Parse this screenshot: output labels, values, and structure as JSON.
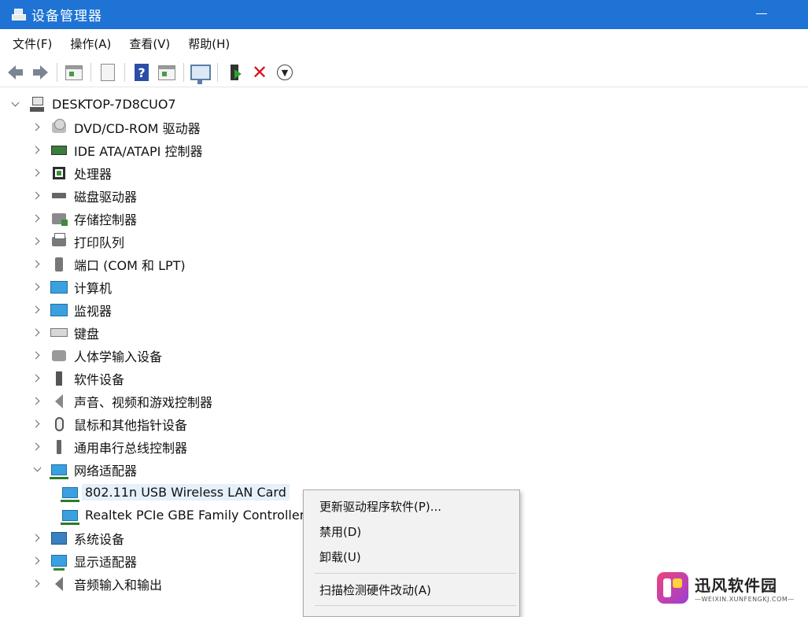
{
  "window": {
    "title": "设备管理器"
  },
  "menu": [
    "文件(F)",
    "操作(A)",
    "查看(V)",
    "帮助(H)"
  ],
  "toolbar_icons": [
    "back-arrow-icon",
    "forward-arrow-icon",
    "show-hide-console-tree-icon",
    "properties-icon",
    "help-icon",
    "action-pane-icon",
    "scan-hardware-icon",
    "update-driver-icon",
    "uninstall-icon",
    "download-icon"
  ],
  "tree": {
    "root": "DESKTOP-7D8CUO7",
    "categories": [
      "DVD/CD-ROM 驱动器",
      "IDE ATA/ATAPI 控制器",
      "处理器",
      "磁盘驱动器",
      "存储控制器",
      "打印队列",
      "端口 (COM 和 LPT)",
      "计算机",
      "监视器",
      "键盘",
      "人体学输入设备",
      "软件设备",
      "声音、视频和游戏控制器",
      "鼠标和其他指针设备",
      "通用串行总线控制器",
      "网络适配器"
    ],
    "network_children": [
      "802.11n USB Wireless LAN Card",
      "Realtek PCIe GBE Family Controller"
    ],
    "after": [
      "系统设备",
      "显示适配器",
      "音频输入和输出"
    ]
  },
  "context_menu": [
    "更新驱动程序软件(P)...",
    "禁用(D)",
    "卸载(U)",
    "扫描检测硬件改动(A)"
  ],
  "watermark": {
    "name": "迅风软件园",
    "url": "—WEIXIN.XUNFENGKJ.COM—"
  }
}
